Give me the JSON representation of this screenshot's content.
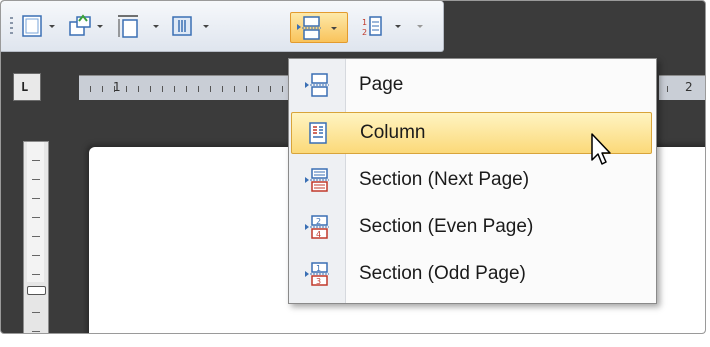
{
  "ruler": {
    "corner_label": "L",
    "left_number": "1",
    "right_number": "2"
  },
  "menu": {
    "items": [
      {
        "label": "Page",
        "icon": "page-break-icon"
      },
      {
        "label": "Column",
        "icon": "column-break-icon"
      },
      {
        "label": "Section (Next Page)",
        "icon": "section-next-page-icon"
      },
      {
        "label": "Section (Even Page)",
        "icon": "section-even-page-icon"
      },
      {
        "label": "Section (Odd Page)",
        "icon": "section-odd-page-icon"
      }
    ],
    "highlighted_index": 1
  },
  "colors": {
    "highlight_top": "#fff4c2",
    "highlight_bottom": "#fbd979",
    "icon_blue": "#3a6fb4",
    "icon_red": "#c0392b",
    "workspace": "#3b3b3b"
  }
}
